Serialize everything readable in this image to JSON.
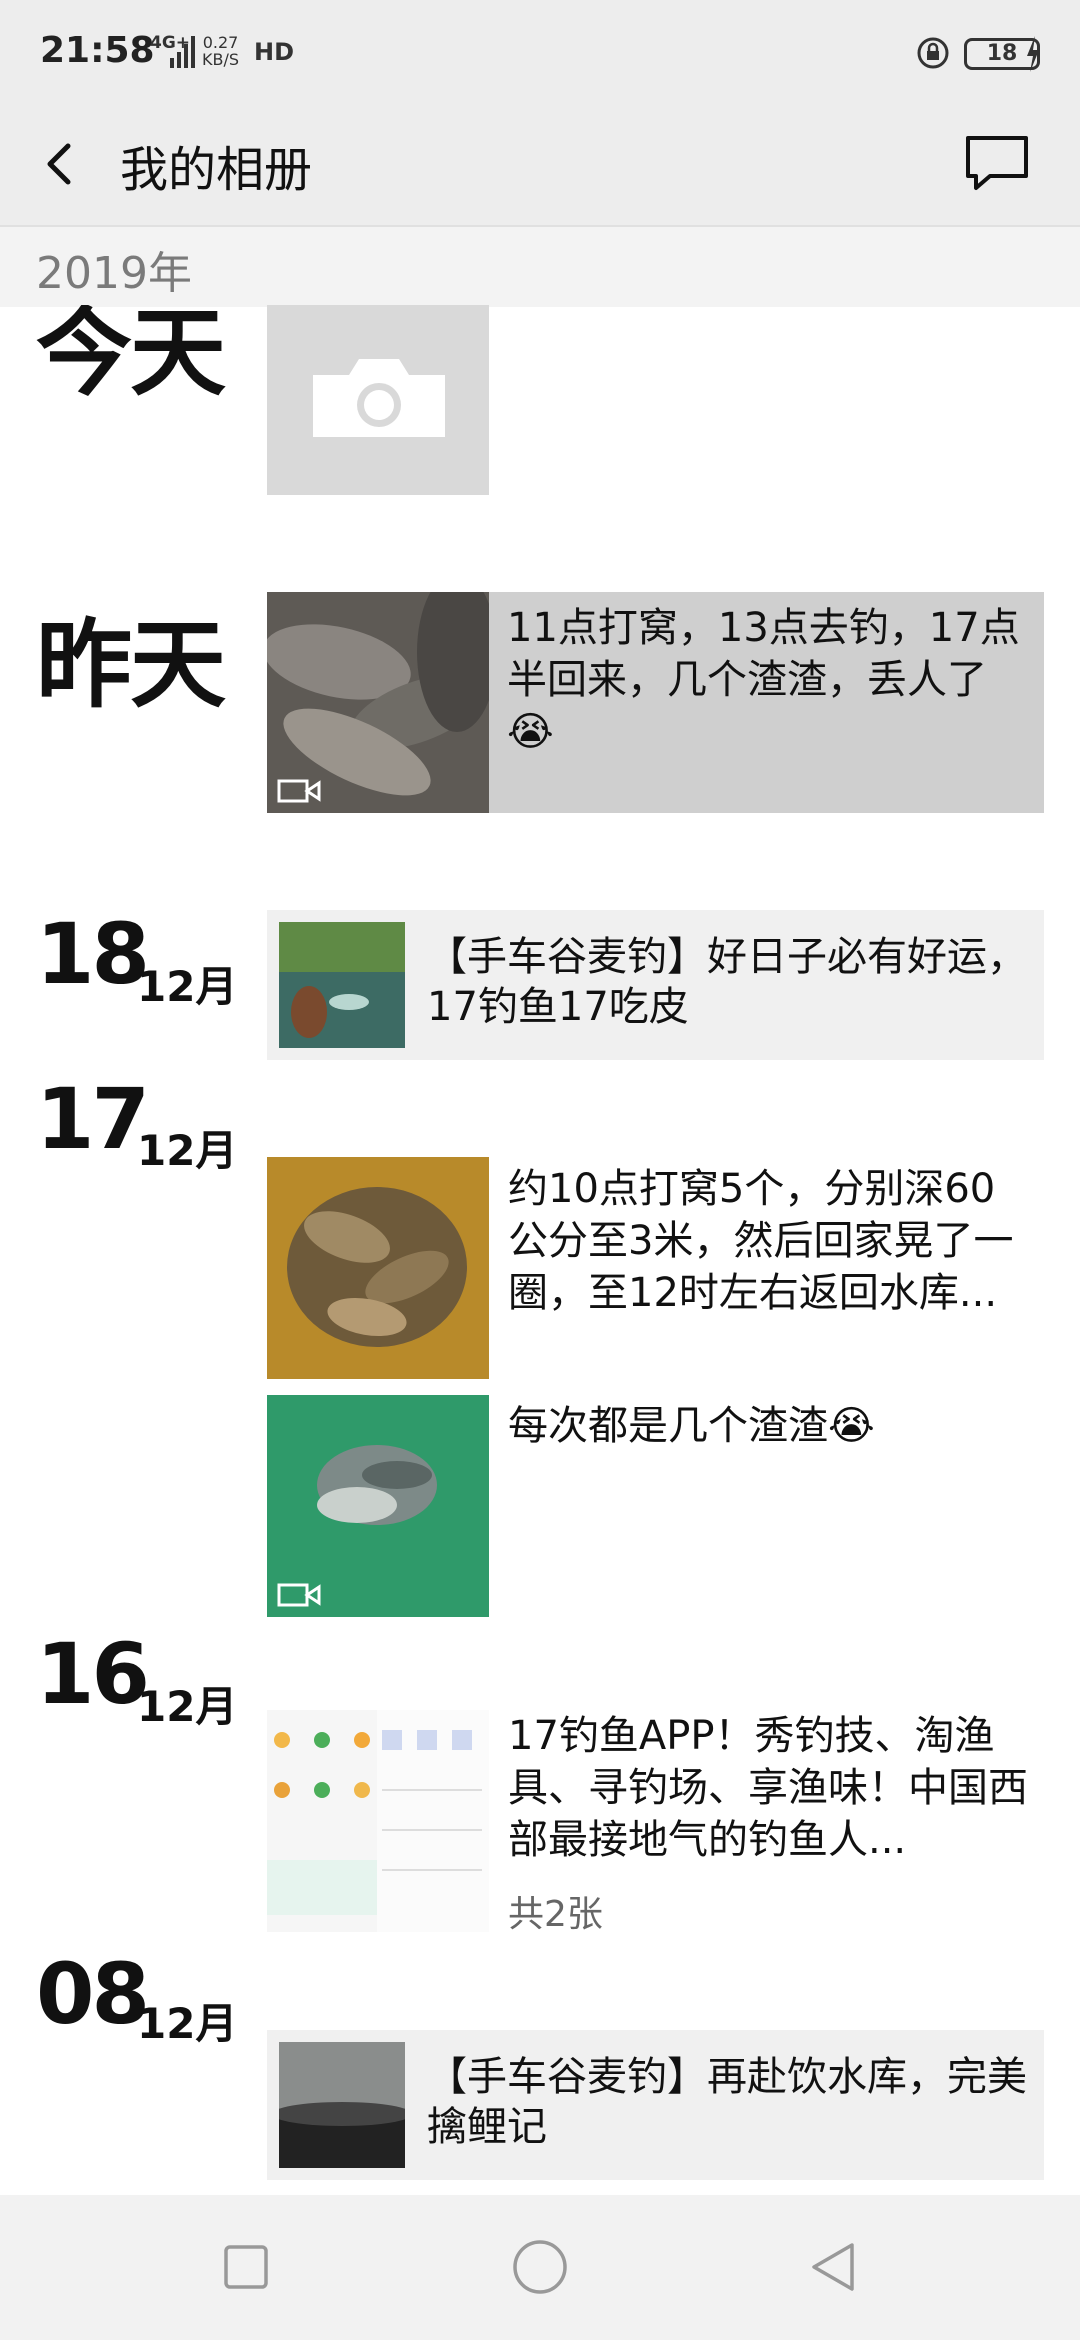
{
  "status_bar": {
    "time": "21:58",
    "network": "4G+",
    "speed_value": "0.27",
    "speed_unit": "KB/S",
    "hd": "HD",
    "battery": "18"
  },
  "header": {
    "title": "我的相册",
    "back_icon": "chevron-left-icon",
    "message_icon": "speech-bubble-icon"
  },
  "year": "2019年",
  "feed": {
    "today": {
      "label": "今天",
      "icon": "camera-icon"
    },
    "yesterday": {
      "label": "昨天",
      "text": "11点打窝，13点去钓，17点半回来，几个渣渣，丢人了😭"
    },
    "d18": {
      "day": "18",
      "month": "12月",
      "shared_text": "【手车谷麦钓】好日子必有好运，17钓鱼17吃皮"
    },
    "d17": {
      "day": "17",
      "month": "12月",
      "post1": "约10点打窝5个，分别深60公分至3米，然后回家晃了一圈，至12时左右返回水库...",
      "post2": "每次都是几个渣渣😭"
    },
    "d16": {
      "day": "16",
      "month": "12月",
      "text": "17钓鱼APP！秀钓技、淘渔具、寻钓场、享渔味！中国西部最接地气的钓鱼人...",
      "count": "共2张"
    },
    "d08": {
      "day": "08",
      "month": "12月",
      "shared_text": "【手车谷麦钓】再赴饮水库，完美擒鲤记"
    }
  },
  "watermark": "17钓鱼APP",
  "nav": {
    "square_icon": "recent-apps-icon",
    "circle_icon": "home-icon",
    "triangle_icon": "back-triangle-icon"
  },
  "colors": {
    "header_bg": "#ededed",
    "camera_tile": "#d9d9d9",
    "card_bg": "#f0f0f0"
  }
}
